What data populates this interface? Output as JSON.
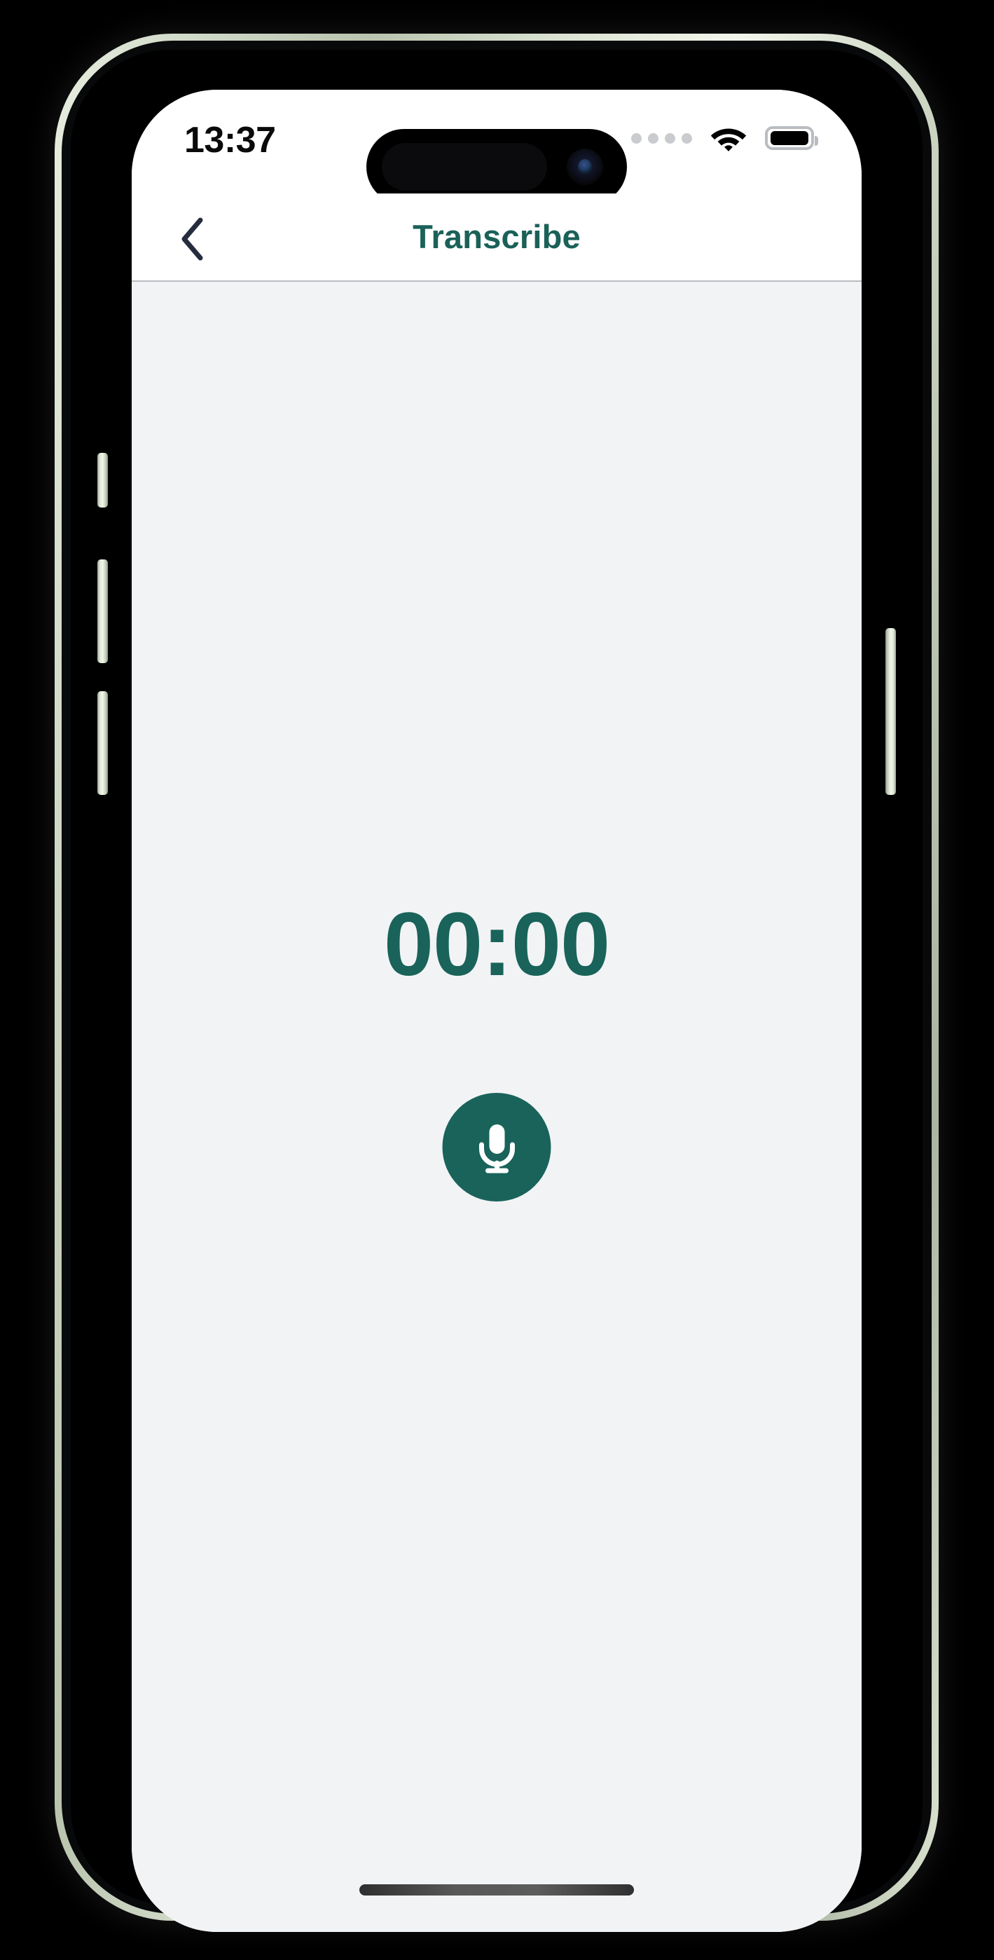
{
  "device": {
    "frame_color": "#cfd8c6",
    "buttons": [
      {
        "name": "action-button"
      },
      {
        "name": "volume-up-button"
      },
      {
        "name": "volume-down-button"
      },
      {
        "name": "power-button"
      }
    ]
  },
  "status_bar": {
    "time": "13:37",
    "cellular_icon": "cellular-dots-icon",
    "cellular_dots": 4,
    "wifi_icon": "wifi-icon",
    "battery_icon": "battery-full-icon",
    "battery_color": "#000000",
    "dots_color": "#c9cbce"
  },
  "nav_bar": {
    "back_icon": "chevron-left-icon",
    "back_icon_color": "#252c3e",
    "title": "Transcribe",
    "title_color": "#1a6158",
    "background": "#ffffff",
    "separator_color": "#b9bcc1"
  },
  "main": {
    "background": "#f2f3f5",
    "timer": "00:00",
    "timer_color": "#19635a",
    "record_button": {
      "icon": "microphone-icon",
      "background": "#19635a",
      "icon_color": "#ffffff"
    }
  },
  "home_indicator": {
    "name": "home-indicator",
    "color": "#4a4a4a"
  }
}
